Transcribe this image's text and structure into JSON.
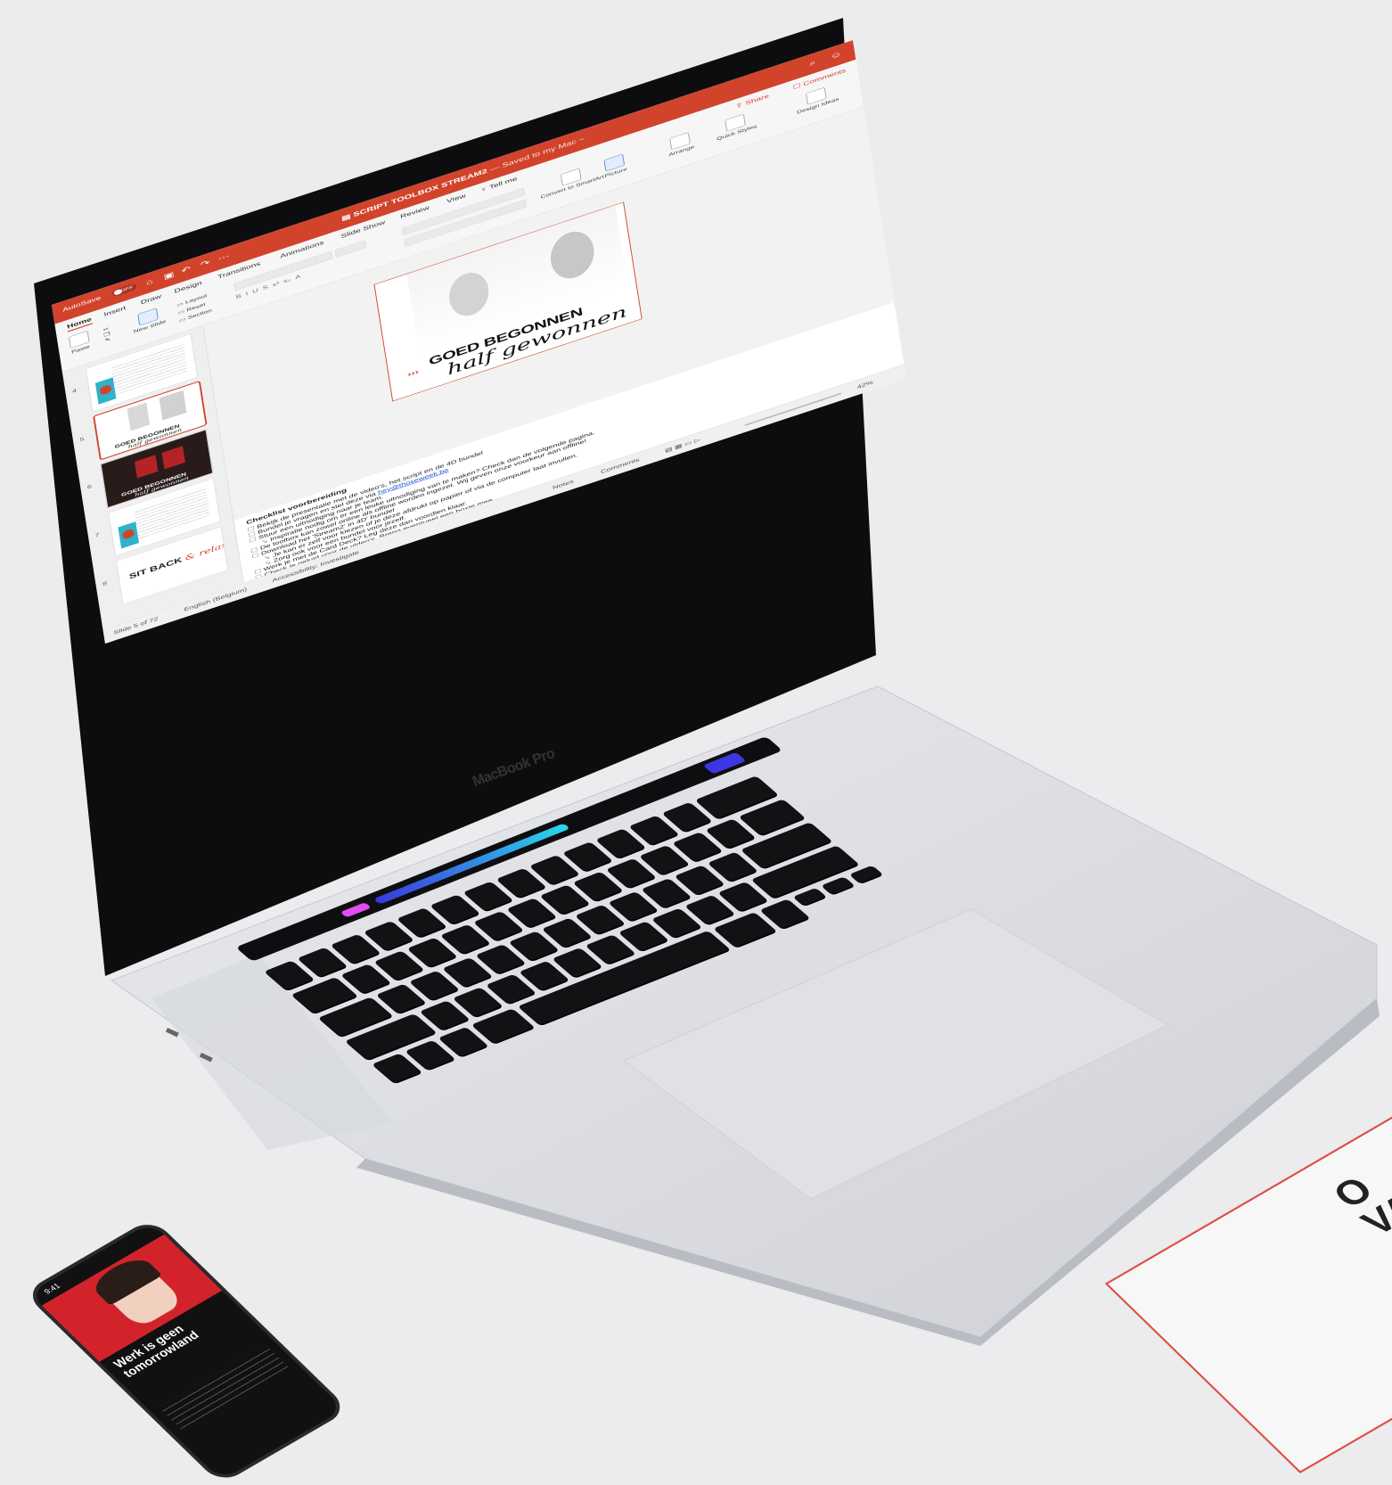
{
  "scene": {
    "background_color": "#ececee",
    "laptop_brand_label": "MacBook Pro"
  },
  "app": {
    "accent_color": "#d2432b",
    "autosave_label": "AutoSave",
    "autosave_state": "OFF",
    "document_title": "SCRIPT TOOLBOX STREAM2",
    "saved_status": "— Saved to my Mac ~",
    "quick_access_icons": [
      "home-icon",
      "save-icon",
      "undo-icon",
      "redo-icon",
      "more-icon"
    ],
    "titlebar_icons": [
      "search-icon",
      "share-person-icon"
    ]
  },
  "ribbon": {
    "tabs": [
      {
        "label": "Home",
        "active": true
      },
      {
        "label": "Insert"
      },
      {
        "label": "Draw"
      },
      {
        "label": "Design"
      },
      {
        "label": "Transitions"
      },
      {
        "label": "Animations"
      },
      {
        "label": "Slide Show"
      },
      {
        "label": "Review"
      },
      {
        "label": "View"
      },
      {
        "label": "Tell me"
      }
    ],
    "share_label": "Share",
    "comments_label": "Comments",
    "paste_label": "Paste",
    "new_slide_label": "New Slide",
    "layout_label": "Layout",
    "reset_label": "Reset",
    "section_label": "Section",
    "convert_label": "Convert to SmartArt",
    "picture_label": "Picture",
    "arrange_label": "Arrange",
    "quick_styles_label": "Quick Styles",
    "design_ideas_label": "Design Ideas"
  },
  "thumbnails": [
    {
      "number": "4",
      "kind": "text-figure"
    },
    {
      "number": "5",
      "kind": "boots",
      "selected": true,
      "caption": "GOED BEGONNEN",
      "script": "half gewonnen"
    },
    {
      "number": "6",
      "kind": "dark",
      "caption": "GOED BEGONNEN",
      "script": "half gewonnen"
    },
    {
      "number": "7",
      "kind": "text-figure"
    },
    {
      "number": "8",
      "kind": "sitback",
      "caption": "SIT BACK",
      "script": "& relax"
    }
  ],
  "slide": {
    "arrows": "›››",
    "title": "GOED BEGONNEN",
    "script": "half gewonnen"
  },
  "notes": {
    "heading": "Checklist voorbereiding",
    "items": [
      {
        "text": "Bekijk de presentatie met de video's, het script en de 4D bundel"
      },
      {
        "text": "Bundel je vragen en stel deze via ",
        "link": "hey@thoseweek.be"
      },
      {
        "text": "Stuur een uitnodiging naar je team."
      },
      {
        "text": "Inspiratie nodig om er een leuke uitnodiging van te maken? Check dan de volgende pagina.",
        "sub": true
      },
      {
        "text": "De toolbox kan zowel online als offline worden ingezet. Wij geven onze voorkeur aan offline!"
      },
      {
        "text": "Download het 'Stream2' in 4D' bundel"
      },
      {
        "text": "Je kan er zelf voor kiezen of je deze afdrukt op papier of via de computer laat invullen.",
        "sub": true
      },
      {
        "text": "Zorg ook voor een bundel voor jezelf.",
        "sub": true
      },
      {
        "text": "Werk je met de Card Deck? Leg deze dan voordien klaar."
      },
      {
        "text": "Check je geluid voor de video's. Breng eventueel een boxje mee."
      }
    ]
  },
  "statusbar": {
    "slide_counter": "Slide 5 of 72",
    "language": "English (Belgium)",
    "accessibility": "Accessibility: Investigate",
    "notes_label": "Notes",
    "comments_label": "Comments",
    "zoom": "42%"
  },
  "phone": {
    "time": "9:41",
    "title": "Werk is geen tomorrowland"
  },
  "booklet": {
    "text_line1": "O",
    "text_line2": "VAN"
  }
}
